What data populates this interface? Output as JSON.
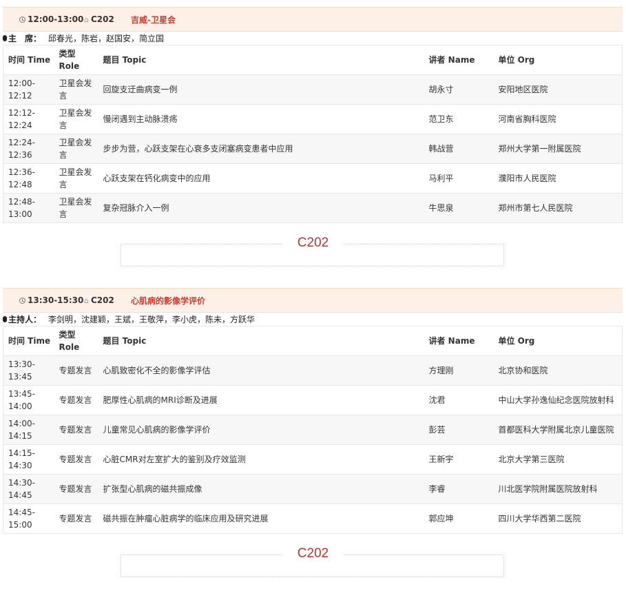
{
  "sessions": [
    {
      "time": "12:00-13:00",
      "room": "C202",
      "title": "吉威-卫星会",
      "chair_label": "主　席：",
      "chairs": "邱春光，陈岩，赵国安，简立国",
      "headers": {
        "time": "时间 Time",
        "role_cn": "类型",
        "role_en": "Role",
        "topic": "题目 Topic",
        "name": "讲者 Name",
        "org": "单位 Org"
      },
      "rows": [
        {
          "time_a": "12:00-",
          "time_b": "12:12",
          "role_a": "卫星会发",
          "role_b": "言",
          "topic": "回旋支迂曲病变一例",
          "name": "胡永寸",
          "org": "安阳地区医院"
        },
        {
          "time_a": "12:12-",
          "time_b": "12:24",
          "role_a": "卫星会发",
          "role_b": "言",
          "topic": "慢闭遇到主动脉溃疡",
          "name": "范卫东",
          "org": "河南省胸科医院"
        },
        {
          "time_a": "12:24-",
          "time_b": "12:36",
          "role_a": "卫星会发",
          "role_b": "言",
          "topic": "步步为营，心跃支架在心衰多支闭塞病变患者中应用",
          "name": "韩战营",
          "org": "郑州大学第一附属医院"
        },
        {
          "time_a": "12:36-",
          "time_b": "12:48",
          "role_a": "卫星会发",
          "role_b": "言",
          "topic": "心跃支架在钙化病变中的应用",
          "name": "马利平",
          "org": "濮阳市人民医院"
        },
        {
          "time_a": "12:48-",
          "time_b": "13:00",
          "role_a": "卫星会发",
          "role_b": "言",
          "topic": "复杂冠脉介入一例",
          "name": "牛思泉",
          "org": "郑州市第七人民医院"
        }
      ],
      "footer_room": "C202"
    },
    {
      "time": "13:30-15:30",
      "room": "C202",
      "title": "心肌病的影像学评价",
      "chair_label": "主持人：",
      "chairs": "李剑明，沈建颖，王斌，王敬萍，李小虎，陈未，方跃华",
      "headers": {
        "time": "时间 Time",
        "role_cn": "类型",
        "role_en": "Role",
        "topic": "题目 Topic",
        "name": "讲者 Name",
        "org": "单位 Org"
      },
      "rows": [
        {
          "time_a": "13:30-",
          "time_b": "13:45",
          "role": "专题发言",
          "topic": "心肌致密化不全的影像学评估",
          "name": "方理刚",
          "org": "北京协和医院"
        },
        {
          "time_a": "13:45-",
          "time_b": "14:00",
          "role": "专题发言",
          "topic": "肥厚性心肌病的MRI诊断及进展",
          "name": "沈君",
          "org": "中山大学孙逸仙纪念医院放射科"
        },
        {
          "time_a": "14:00-",
          "time_b": "14:15",
          "role": "专题发言",
          "topic": "儿童常见心肌病的影像学评价",
          "name": "彭芸",
          "org": "首都医科大学附属北京儿童医院"
        },
        {
          "time_a": "14:15-",
          "time_b": "14:30",
          "role": "专题发言",
          "topic": "心脏CMR对左室扩大的鉴别及疗效监测",
          "name": "王新宇",
          "org": "北京大学第三医院"
        },
        {
          "time_a": "14:30-",
          "time_b": "14:45",
          "role": "专题发言",
          "topic": "扩张型心肌病的磁共振成像",
          "name": "李睿",
          "org": "川北医学院附属医院放射科"
        },
        {
          "time_a": "14:45-",
          "time_b": "15:00",
          "role": "专题发言",
          "topic": "磁共振在肿瘤心脏病学的临床应用及研究进展",
          "name": "郭应坤",
          "org": "四川大学华西第二医院"
        }
      ],
      "footer_room": "C202"
    }
  ]
}
